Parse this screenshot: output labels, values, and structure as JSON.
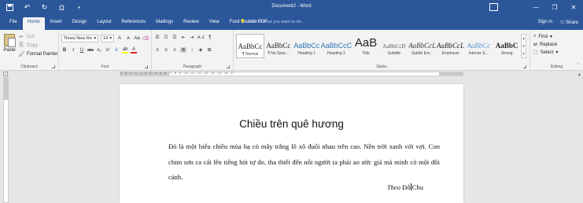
{
  "window": {
    "title": "Document2 - Word",
    "controls": [
      "minimize-icon",
      "restore-icon",
      "close-icon"
    ]
  },
  "quick_access": [
    "save-icon",
    "undo-icon",
    "redo-icon",
    "omega-icon",
    "customize-icon"
  ],
  "tabs": [
    {
      "label": "File",
      "active": false
    },
    {
      "label": "Home",
      "active": true
    },
    {
      "label": "Insert",
      "active": false
    },
    {
      "label": "Design",
      "active": false
    },
    {
      "label": "Layout",
      "active": false
    },
    {
      "label": "References",
      "active": false
    },
    {
      "label": "Mailings",
      "active": false
    },
    {
      "label": "Review",
      "active": false
    },
    {
      "label": "View",
      "active": false
    },
    {
      "label": "Foxit Reader PDF",
      "active": false
    }
  ],
  "tell_me": "Tell me what you want to do...",
  "account": {
    "sign_in": "Sign in",
    "share": "Share"
  },
  "ribbon": {
    "clipboard": {
      "label": "Clipboard",
      "paste": "Paste",
      "cut": "Cut",
      "copy": "Copy",
      "format_painter": "Format Painter"
    },
    "font": {
      "label": "Font",
      "font_name": "Times New Ro",
      "font_size": "14",
      "grow": "A",
      "shrink": "A",
      "change_case": "Aa",
      "bold": "B",
      "italic": "I",
      "underline": "U",
      "strikethrough": "abc",
      "subscript": "x₂",
      "superscript": "x²"
    },
    "paragraph": {
      "label": "Paragraph",
      "sort": "A↓Z",
      "pilcrow": "¶"
    },
    "styles": {
      "label": "Styles",
      "items": [
        {
          "preview": "AaBbCc",
          "name": "¶ Normal",
          "selected": true,
          "color": "#222222"
        },
        {
          "preview": "AaBbCc",
          "name": "¶ No Spac...",
          "selected": false,
          "color": "#222222"
        },
        {
          "preview": "AaBbCc",
          "name": "Heading 1",
          "selected": false,
          "color": "#2e74b5"
        },
        {
          "preview": "AaBbCcC",
          "name": "Heading 2",
          "selected": false,
          "color": "#2e74b5"
        },
        {
          "preview": "AaB",
          "name": "Title",
          "selected": false,
          "color": "#222222"
        },
        {
          "preview": "AaBbCcD",
          "name": "Subtitle",
          "selected": false,
          "color": "#5a5a5a"
        },
        {
          "preview": "AaBbCcL",
          "name": "Subtle Em...",
          "selected": false,
          "color": "#404040"
        },
        {
          "preview": "AaBbCcL",
          "name": "Emphasis",
          "selected": false,
          "color": "#222222"
        },
        {
          "preview": "AaBbCc",
          "name": "Intense E...",
          "selected": false,
          "color": "#5b9bd5"
        },
        {
          "preview": "AaBbC",
          "name": "Strong",
          "selected": false,
          "color": "#222222"
        }
      ]
    },
    "editing": {
      "label": "Editing",
      "find": "Find",
      "replace": "Replace",
      "select": "Select"
    }
  },
  "ruler": {
    "numbers": "3 · 2 · 1 · 1 · 1 · 2 · 3 · 4 · 5 · 6 · 7 · 8 · 9 · 10 · 11 · 12 · 13 · 14 · 15 · 16 · 17",
    "corner": "L"
  },
  "document": {
    "heading": "Chiều trên quê hương",
    "paragraph": "Đó là một biểu chiều mùa hạ có mây trắng lô xô đuổi nhau trên cao. Nền trời xanh vời vợi. Con chim sơn ca cất lên tiếng hót tự do, tha thiết đến nỗi người ta phải ao ước giá mà mình có một đôi cánh.",
    "attribution_prefix": "Theo",
    "attribution_author_a": "Đỗ",
    "attribution_author_b": "Chu"
  }
}
